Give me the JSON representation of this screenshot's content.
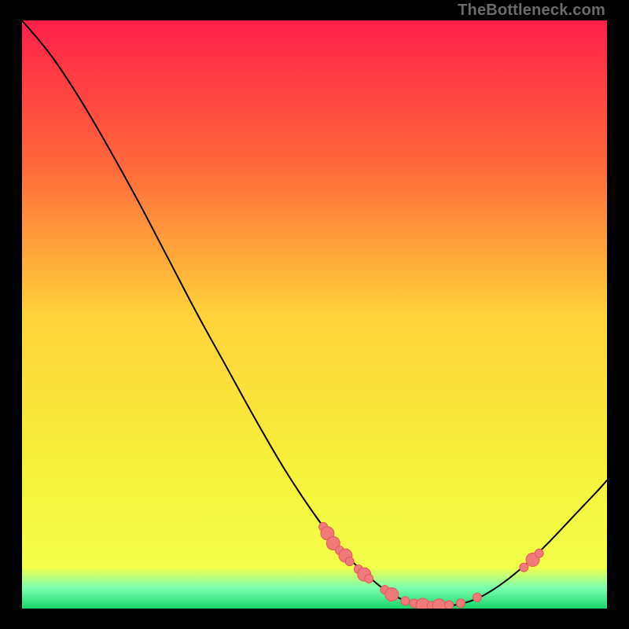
{
  "attribution": "TheBottleneck.com",
  "chart_data": {
    "type": "line",
    "title": "",
    "xlabel": "",
    "ylabel": "",
    "xlim": [
      0,
      100
    ],
    "ylim": [
      0,
      100
    ],
    "background_gradient": {
      "stops": [
        {
          "offset": 0.0,
          "color": "#ff1f4a"
        },
        {
          "offset": 0.25,
          "color": "#ff6a3a"
        },
        {
          "offset": 0.5,
          "color": "#ffd23a"
        },
        {
          "offset": 0.75,
          "color": "#f6f03a"
        },
        {
          "offset": 0.93,
          "color": "#f3ff4a"
        },
        {
          "offset": 0.965,
          "color": "#7bffb0"
        },
        {
          "offset": 1.0,
          "color": "#18d66a"
        }
      ]
    },
    "curve": {
      "stroke": "#000000",
      "stroke_width": 2,
      "points": [
        {
          "x": 0.0,
          "y": 100.0
        },
        {
          "x": 5.0,
          "y": 94.0
        },
        {
          "x": 10.0,
          "y": 86.5
        },
        {
          "x": 15.0,
          "y": 78.0
        },
        {
          "x": 20.0,
          "y": 69.0
        },
        {
          "x": 25.0,
          "y": 59.5
        },
        {
          "x": 30.0,
          "y": 50.0
        },
        {
          "x": 35.0,
          "y": 41.0
        },
        {
          "x": 40.0,
          "y": 32.0
        },
        {
          "x": 45.0,
          "y": 23.5
        },
        {
          "x": 50.0,
          "y": 16.0
        },
        {
          "x": 55.0,
          "y": 9.5
        },
        {
          "x": 60.0,
          "y": 4.8
        },
        {
          "x": 63.0,
          "y": 2.6
        },
        {
          "x": 66.0,
          "y": 1.2
        },
        {
          "x": 70.0,
          "y": 0.5
        },
        {
          "x": 74.0,
          "y": 0.6
        },
        {
          "x": 78.0,
          "y": 1.8
        },
        {
          "x": 82.0,
          "y": 4.2
        },
        {
          "x": 86.0,
          "y": 7.4
        },
        {
          "x": 90.0,
          "y": 11.2
        },
        {
          "x": 94.0,
          "y": 15.4
        },
        {
          "x": 98.0,
          "y": 19.6
        },
        {
          "x": 100.0,
          "y": 21.8
        }
      ]
    },
    "markers": {
      "fill": "#f07a7a",
      "stroke": "#e05858",
      "radius_small": 5.5,
      "radius_large": 8.5,
      "points": [
        {
          "x": 51.5,
          "y": 13.9,
          "r": "small"
        },
        {
          "x": 52.2,
          "y": 12.8,
          "r": "large"
        },
        {
          "x": 53.2,
          "y": 11.1,
          "r": "large"
        },
        {
          "x": 54.3,
          "y": 9.9,
          "r": "small"
        },
        {
          "x": 55.3,
          "y": 9.0,
          "r": "large"
        },
        {
          "x": 56.0,
          "y": 8.0,
          "r": "small"
        },
        {
          "x": 57.5,
          "y": 6.7,
          "r": "small"
        },
        {
          "x": 58.5,
          "y": 5.8,
          "r": "large"
        },
        {
          "x": 59.3,
          "y": 5.1,
          "r": "small"
        },
        {
          "x": 62.0,
          "y": 3.2,
          "r": "small"
        },
        {
          "x": 63.2,
          "y": 2.4,
          "r": "large"
        },
        {
          "x": 65.5,
          "y": 1.3,
          "r": "small"
        },
        {
          "x": 67.0,
          "y": 0.9,
          "r": "small"
        },
        {
          "x": 68.5,
          "y": 0.6,
          "r": "large"
        },
        {
          "x": 70.0,
          "y": 0.5,
          "r": "small"
        },
        {
          "x": 71.3,
          "y": 0.5,
          "r": "large"
        },
        {
          "x": 73.0,
          "y": 0.6,
          "r": "small"
        },
        {
          "x": 75.0,
          "y": 0.9,
          "r": "small"
        },
        {
          "x": 77.8,
          "y": 1.9,
          "r": "small"
        },
        {
          "x": 85.8,
          "y": 7.0,
          "r": "small"
        },
        {
          "x": 87.3,
          "y": 8.3,
          "r": "large"
        },
        {
          "x": 88.4,
          "y": 9.4,
          "r": "small"
        }
      ]
    }
  }
}
